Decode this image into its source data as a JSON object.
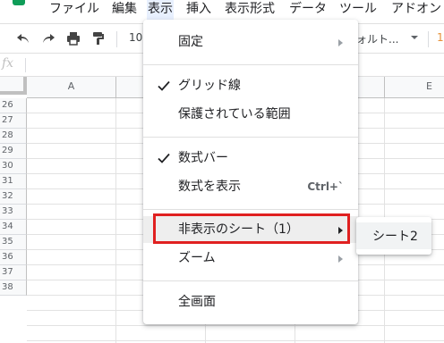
{
  "menubar": {
    "items": [
      {
        "label": "ファイル"
      },
      {
        "label": "編集"
      },
      {
        "label": "表示"
      },
      {
        "label": "挿入"
      },
      {
        "label": "表示形式"
      },
      {
        "label": "データ"
      },
      {
        "label": "ツール"
      },
      {
        "label": "アドオン"
      }
    ],
    "active_item": "表示"
  },
  "toolbar": {
    "undo_icon": "undo-icon",
    "redo_icon": "redo-icon",
    "print_icon": "print-icon",
    "paint_format_icon": "paint-format-icon",
    "zoom_value": "10",
    "font_value": "ォルト..."
  },
  "formulabar": {
    "fx_label": "fx"
  },
  "grid": {
    "columns": [
      {
        "label": "A"
      },
      {
        "label": "E"
      }
    ],
    "rows": [
      "26",
      "27",
      "28",
      "29",
      "30",
      "31",
      "32",
      "33",
      "34",
      "35",
      "36",
      "37",
      "38"
    ]
  },
  "view_menu": {
    "items": [
      {
        "label": "固定",
        "has_submenu": true
      },
      {
        "label": "グリッド線",
        "checked": true
      },
      {
        "label": "保護されている範囲"
      },
      {
        "label": "数式バー",
        "checked": true
      },
      {
        "label": "数式を表示",
        "shortcut": "Ctrl+`"
      },
      {
        "label": "非表示のシート（1）",
        "has_submenu": true,
        "highlighted": true
      },
      {
        "label": "ズーム",
        "has_submenu": true
      },
      {
        "label": "全画面"
      }
    ]
  },
  "hidden_sheets_submenu": {
    "items": [
      {
        "label": "シート2"
      }
    ]
  },
  "colors": {
    "accent_highlight": "#e8f0fe",
    "annotation_red": "#e02020",
    "sheets_green": "#0f9d58"
  }
}
